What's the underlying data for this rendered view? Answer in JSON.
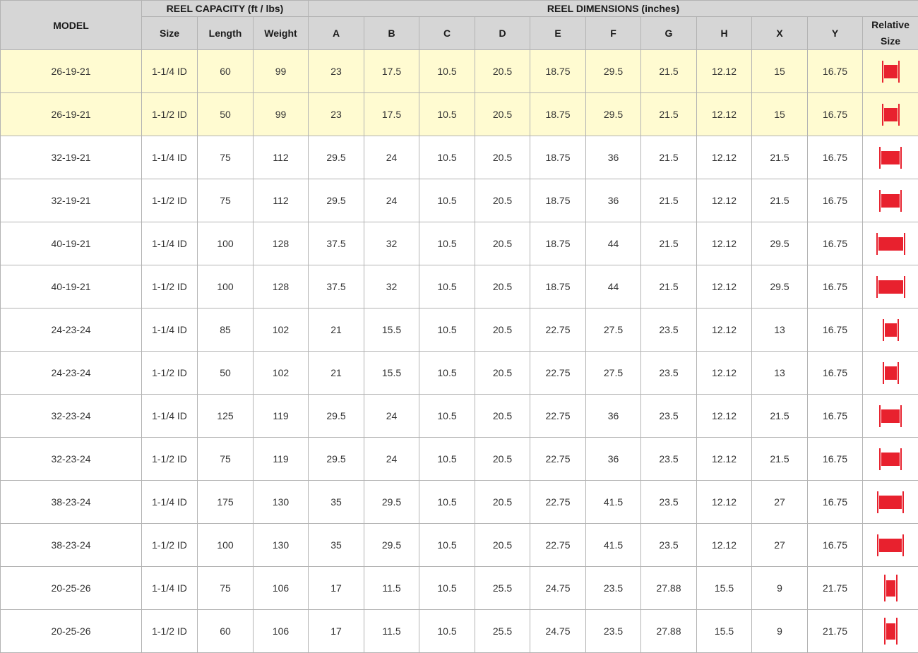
{
  "headers": {
    "model": "MODEL",
    "reel_capacity": "REEL CAPACITY (ft / lbs)",
    "reel_dimensions": "REEL DIMENSIONS (inches)",
    "size": "Size",
    "length": "Length",
    "weight": "Weight",
    "a": "A",
    "b": "B",
    "c": "C",
    "d": "D",
    "e": "E",
    "f": "F",
    "g": "G",
    "h": "H",
    "x": "X",
    "y": "Y",
    "relative_line1": "Relative",
    "relative_line2": "Size"
  },
  "icon": {
    "name": "reel-size-icon",
    "color": "#e8212e"
  },
  "rows": [
    {
      "model": "26-19-21",
      "size": "1-1/4 ID",
      "length": "60",
      "weight": "99",
      "a": "23",
      "b": "17.5",
      "c": "10.5",
      "d": "20.5",
      "e": "18.75",
      "f": "29.5",
      "g": "21.5",
      "h": "12.12",
      "x": "15",
      "y": "16.75",
      "highlight": true
    },
    {
      "model": "26-19-21",
      "size": "1-1/2 ID",
      "length": "50",
      "weight": "99",
      "a": "23",
      "b": "17.5",
      "c": "10.5",
      "d": "20.5",
      "e": "18.75",
      "f": "29.5",
      "g": "21.5",
      "h": "12.12",
      "x": "15",
      "y": "16.75",
      "highlight": true
    },
    {
      "model": "32-19-21",
      "size": "1-1/4 ID",
      "length": "75",
      "weight": "112",
      "a": "29.5",
      "b": "24",
      "c": "10.5",
      "d": "20.5",
      "e": "18.75",
      "f": "36",
      "g": "21.5",
      "h": "12.12",
      "x": "21.5",
      "y": "16.75",
      "highlight": false
    },
    {
      "model": "32-19-21",
      "size": "1-1/2 ID",
      "length": "75",
      "weight": "112",
      "a": "29.5",
      "b": "24",
      "c": "10.5",
      "d": "20.5",
      "e": "18.75",
      "f": "36",
      "g": "21.5",
      "h": "12.12",
      "x": "21.5",
      "y": "16.75",
      "highlight": false
    },
    {
      "model": "40-19-21",
      "size": "1-1/4 ID",
      "length": "100",
      "weight": "128",
      "a": "37.5",
      "b": "32",
      "c": "10.5",
      "d": "20.5",
      "e": "18.75",
      "f": "44",
      "g": "21.5",
      "h": "12.12",
      "x": "29.5",
      "y": "16.75",
      "highlight": false
    },
    {
      "model": "40-19-21",
      "size": "1-1/2 ID",
      "length": "100",
      "weight": "128",
      "a": "37.5",
      "b": "32",
      "c": "10.5",
      "d": "20.5",
      "e": "18.75",
      "f": "44",
      "g": "21.5",
      "h": "12.12",
      "x": "29.5",
      "y": "16.75",
      "highlight": false
    },
    {
      "model": "24-23-24",
      "size": "1-1/4 ID",
      "length": "85",
      "weight": "102",
      "a": "21",
      "b": "15.5",
      "c": "10.5",
      "d": "20.5",
      "e": "22.75",
      "f": "27.5",
      "g": "23.5",
      "h": "12.12",
      "x": "13",
      "y": "16.75",
      "highlight": false
    },
    {
      "model": "24-23-24",
      "size": "1-1/2 ID",
      "length": "50",
      "weight": "102",
      "a": "21",
      "b": "15.5",
      "c": "10.5",
      "d": "20.5",
      "e": "22.75",
      "f": "27.5",
      "g": "23.5",
      "h": "12.12",
      "x": "13",
      "y": "16.75",
      "highlight": false
    },
    {
      "model": "32-23-24",
      "size": "1-1/4 ID",
      "length": "125",
      "weight": "119",
      "a": "29.5",
      "b": "24",
      "c": "10.5",
      "d": "20.5",
      "e": "22.75",
      "f": "36",
      "g": "23.5",
      "h": "12.12",
      "x": "21.5",
      "y": "16.75",
      "highlight": false
    },
    {
      "model": "32-23-24",
      "size": "1-1/2 ID",
      "length": "75",
      "weight": "119",
      "a": "29.5",
      "b": "24",
      "c": "10.5",
      "d": "20.5",
      "e": "22.75",
      "f": "36",
      "g": "23.5",
      "h": "12.12",
      "x": "21.5",
      "y": "16.75",
      "highlight": false
    },
    {
      "model": "38-23-24",
      "size": "1-1/4 ID",
      "length": "175",
      "weight": "130",
      "a": "35",
      "b": "29.5",
      "c": "10.5",
      "d": "20.5",
      "e": "22.75",
      "f": "41.5",
      "g": "23.5",
      "h": "12.12",
      "x": "27",
      "y": "16.75",
      "highlight": false
    },
    {
      "model": "38-23-24",
      "size": "1-1/2 ID",
      "length": "100",
      "weight": "130",
      "a": "35",
      "b": "29.5",
      "c": "10.5",
      "d": "20.5",
      "e": "22.75",
      "f": "41.5",
      "g": "23.5",
      "h": "12.12",
      "x": "27",
      "y": "16.75",
      "highlight": false
    },
    {
      "model": "20-25-26",
      "size": "1-1/4 ID",
      "length": "75",
      "weight": "106",
      "a": "17",
      "b": "11.5",
      "c": "10.5",
      "d": "25.5",
      "e": "24.75",
      "f": "23.5",
      "g": "27.88",
      "h": "15.5",
      "x": "9",
      "y": "21.75",
      "highlight": false
    },
    {
      "model": "20-25-26",
      "size": "1-1/2 ID",
      "length": "60",
      "weight": "106",
      "a": "17",
      "b": "11.5",
      "c": "10.5",
      "d": "25.5",
      "e": "24.75",
      "f": "23.5",
      "g": "27.88",
      "h": "15.5",
      "x": "9",
      "y": "21.75",
      "highlight": false
    }
  ]
}
